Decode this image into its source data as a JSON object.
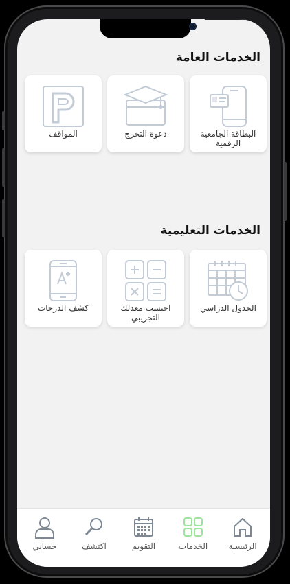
{
  "sections": {
    "general": {
      "title": "الخدمات العامة",
      "items": [
        {
          "label": "البطاقة الجامعية الرقمية",
          "icon": "digital-id-card-icon"
        },
        {
          "label": "دعوة التخرج",
          "icon": "graduation-invitation-icon"
        },
        {
          "label": "المواقف",
          "icon": "parking-icon"
        }
      ]
    },
    "educational": {
      "title": "الخدمات التعليمية",
      "items": [
        {
          "label": "الجدول الدراسي",
          "icon": "schedule-calendar-icon"
        },
        {
          "label": "احتسب معدلك التجريبي",
          "icon": "calculator-icon"
        },
        {
          "label": "كشف الدرجات",
          "icon": "grades-report-icon"
        }
      ]
    }
  },
  "tabbar": {
    "items": [
      {
        "label": "الرئيسية",
        "icon": "home-icon"
      },
      {
        "label": "الخدمات",
        "icon": "grid-icon",
        "active": true
      },
      {
        "label": "التقويم",
        "icon": "calendar-icon"
      },
      {
        "label": "اكتشف",
        "icon": "search-icon"
      },
      {
        "label": "حسابي",
        "icon": "profile-icon"
      }
    ]
  },
  "colors": {
    "icon_gray": "#c3cbd6",
    "active_green": "#9be59b",
    "tab_icon": "#7d8894"
  }
}
